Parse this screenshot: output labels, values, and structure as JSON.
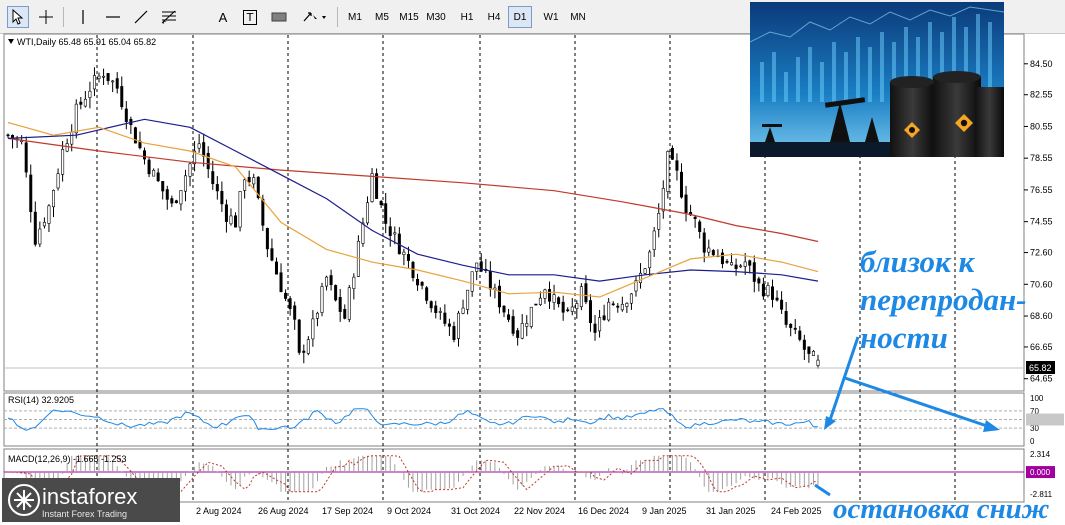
{
  "toolbar": {
    "cursor_icon": "cursor-icon",
    "crosshair_icon": "crosshair-icon",
    "vline_icon": "vertical-line-icon",
    "hline_icon": "horizontal-line-icon",
    "trendline_icon": "trendline-icon",
    "fibo_icon": "fibonacci-icon",
    "text_tool": "A",
    "label_tool": "T",
    "rect_icon": "rectangle-icon",
    "arrows_icon": "arrows-icon",
    "timeframes": [
      "M1",
      "M5",
      "M15",
      "M30",
      "H1",
      "H4",
      "D1",
      "W1",
      "MN"
    ],
    "active_timeframe": "D1"
  },
  "main_chart": {
    "info": "WTI,Daily  65.48 65.91 65.04 65.82",
    "current_price": "65.82",
    "price_ticks": [
      "84.50",
      "82.55",
      "80.55",
      "78.55",
      "76.55",
      "74.55",
      "72.60",
      "70.60",
      "68.60",
      "66.65",
      "64.65"
    ]
  },
  "rsi": {
    "label": "RSI(14) 32.9205",
    "ticks": [
      "100",
      "70",
      "50.0000",
      "30",
      "0"
    ],
    "current_box": "50.0000"
  },
  "macd": {
    "label": "MACD(12,26,9) -1.665 -1.253",
    "ticks": [
      "2.314",
      "0.000",
      "-2.811"
    ]
  },
  "date_labels": [
    "2 Aug 2024",
    "26 Aug 2024",
    "17 Sep 2024",
    "9 Oct 2024",
    "31 Oct 2024",
    "22 Nov 2024",
    "16 Dec 2024",
    "9 Jan 2025",
    "31 Jan 2025",
    "24 Feb 2025"
  ],
  "logo": {
    "name": "instaforex",
    "tagline": "Instant Forex Trading"
  },
  "annotations": {
    "line1": "близок к",
    "line2": "перепродан-",
    "line3": "ности",
    "bottom": "остановка сниж"
  },
  "colors": {
    "candle": "#000000",
    "ma_fast": "#e8a33c",
    "ma_mid": "#1c1c8c",
    "ma_slow": "#c0392b",
    "rsi_line": "#1e88e5",
    "macd_hist": "#a0a0a0",
    "macd_signal": "#c0392b",
    "annotation": "#1e88e5"
  },
  "chart_data": {
    "type": "candlestick",
    "symbol": "WTI",
    "timeframe": "Daily",
    "last_bar": {
      "open": 65.48,
      "high": 65.91,
      "low": 65.04,
      "close": 65.82
    },
    "ylim": [
      64.0,
      86.0
    ],
    "close_path": [
      [
        0,
        80.0
      ],
      [
        6,
        79.5
      ],
      [
        12,
        73.5
      ],
      [
        18,
        75.5
      ],
      [
        24,
        79.0
      ],
      [
        30,
        81.5
      ],
      [
        36,
        83.0
      ],
      [
        42,
        84.0
      ],
      [
        48,
        83.0
      ],
      [
        54,
        80.5
      ],
      [
        60,
        78.5
      ],
      [
        66,
        77.0
      ],
      [
        72,
        75.5
      ],
      [
        78,
        77.5
      ],
      [
        84,
        79.5
      ],
      [
        90,
        77.0
      ],
      [
        96,
        75.0
      ],
      [
        100,
        74.5
      ],
      [
        104,
        77.5
      ],
      [
        108,
        77.0
      ],
      [
        114,
        73.0
      ],
      [
        120,
        70.5
      ],
      [
        126,
        68.0
      ],
      [
        128,
        66.0
      ],
      [
        134,
        68.0
      ],
      [
        140,
        71.0
      ],
      [
        144,
        69.5
      ],
      [
        148,
        68.5
      ],
      [
        152,
        71.5
      ],
      [
        156,
        74.5
      ],
      [
        160,
        77.5
      ],
      [
        166,
        74.5
      ],
      [
        172,
        73.0
      ],
      [
        178,
        71.5
      ],
      [
        184,
        70.0
      ],
      [
        190,
        68.5
      ],
      [
        196,
        67.5
      ],
      [
        200,
        69.5
      ],
      [
        206,
        72.0
      ],
      [
        212,
        70.5
      ],
      [
        218,
        69.0
      ],
      [
        224,
        67.5
      ],
      [
        230,
        69.0
      ],
      [
        236,
        70.5
      ],
      [
        240,
        69.5
      ],
      [
        246,
        68.5
      ],
      [
        252,
        70.0
      ],
      [
        258,
        67.5
      ],
      [
        264,
        69.5
      ],
      [
        270,
        69.5
      ],
      [
        276,
        70.5
      ],
      [
        282,
        72.5
      ],
      [
        286,
        75.0
      ],
      [
        290,
        78.5
      ],
      [
        294,
        77.5
      ],
      [
        298,
        75.5
      ],
      [
        302,
        74.5
      ],
      [
        306,
        73.0
      ],
      [
        312,
        72.5
      ],
      [
        318,
        71.5
      ],
      [
        324,
        72.0
      ],
      [
        330,
        70.5
      ],
      [
        336,
        70.0
      ],
      [
        342,
        68.0
      ],
      [
        348,
        67.0
      ],
      [
        352,
        66.0
      ],
      [
        356,
        65.8
      ]
    ],
    "ma_fast": [
      [
        0,
        80.8
      ],
      [
        20,
        80.0
      ],
      [
        40,
        80.5
      ],
      [
        60,
        79.5
      ],
      [
        80,
        79.0
      ],
      [
        100,
        78.0
      ],
      [
        120,
        74.5
      ],
      [
        140,
        72.8
      ],
      [
        160,
        72.0
      ],
      [
        180,
        71.5
      ],
      [
        200,
        70.8
      ],
      [
        220,
        70.0
      ],
      [
        240,
        70.1
      ],
      [
        260,
        69.8
      ],
      [
        280,
        71.0
      ],
      [
        300,
        72.2
      ],
      [
        320,
        72.5
      ],
      [
        340,
        72.0
      ],
      [
        356,
        71.4
      ]
    ],
    "ma_mid": [
      [
        0,
        79.8
      ],
      [
        30,
        80.0
      ],
      [
        60,
        81.0
      ],
      [
        80,
        80.5
      ],
      [
        100,
        79.0
      ],
      [
        120,
        77.5
      ],
      [
        140,
        76.0
      ],
      [
        160,
        74.0
      ],
      [
        180,
        72.5
      ],
      [
        200,
        71.8
      ],
      [
        220,
        71.2
      ],
      [
        240,
        71.2
      ],
      [
        260,
        70.8
      ],
      [
        280,
        71.2
      ],
      [
        300,
        71.5
      ],
      [
        320,
        71.4
      ],
      [
        340,
        71.2
      ],
      [
        356,
        70.8
      ]
    ],
    "ma_slow": [
      [
        0,
        79.8
      ],
      [
        40,
        79.0
      ],
      [
        80,
        78.3
      ],
      [
        120,
        77.8
      ],
      [
        160,
        77.4
      ],
      [
        200,
        77.0
      ],
      [
        240,
        76.5
      ],
      [
        270,
        75.8
      ],
      [
        300,
        75.0
      ],
      [
        320,
        74.3
      ],
      [
        340,
        73.8
      ],
      [
        356,
        73.3
      ]
    ],
    "rsi": {
      "current": 32.9205,
      "levels": [
        70,
        50,
        30
      ],
      "ylim": [
        0,
        100
      ]
    },
    "macd": {
      "main": -1.665,
      "signal": -1.253,
      "ylim": [
        -2.811,
        2.314
      ]
    }
  }
}
